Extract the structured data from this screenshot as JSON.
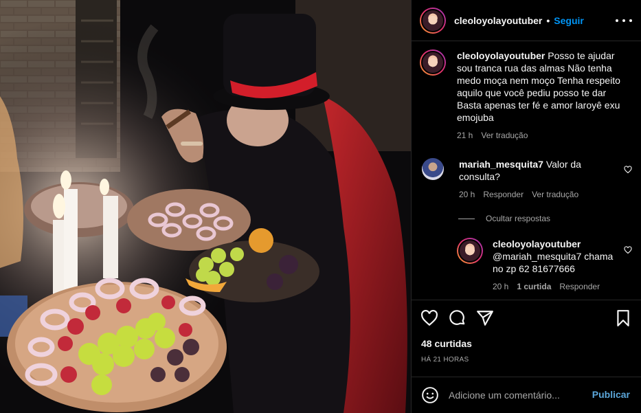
{
  "post": {
    "username": "cleoloyolayoutuber",
    "dot": "•",
    "follow_label": "Seguir"
  },
  "caption": {
    "username": "cleoloyolayoutuber",
    "text": "Posso te ajudar sou tranca rua das almas Não tenha medo moça nem moço Tenha respeito aquilo que você pediu posso te dar Basta apenas ter fé e amor laroyê exu emojuba",
    "time": "21 h",
    "translate_label": "Ver tradução"
  },
  "comments": [
    {
      "username": "mariah_mesquita7",
      "text": "Valor da consulta?",
      "time": "20 h",
      "reply_label": "Responder",
      "translate_label": "Ver tradução"
    }
  ],
  "hide_replies_label": "Ocultar respostas",
  "reply": {
    "username": "cleoloyolayoutuber",
    "text": "@mariah_mesquita7 chama no zp 62 81677666",
    "time": "20 h",
    "likes": "1 curtida",
    "reply_label": "Responder"
  },
  "likes_label": "48 curtidas",
  "time_ago": "HÁ 21 HORAS",
  "comment_box": {
    "placeholder": "Adicione um comentário...",
    "publish_label": "Publicar"
  },
  "icons": {
    "more": "more-options-icon",
    "like": "heart-icon",
    "comment": "comment-icon",
    "share": "share-icon",
    "save": "bookmark-icon",
    "emoji": "emoji-icon"
  },
  "colors": {
    "accent": "#0095f6",
    "publish": "#6cc3ff",
    "secondary_text": "#a8a8a8",
    "divider": "#262626"
  }
}
